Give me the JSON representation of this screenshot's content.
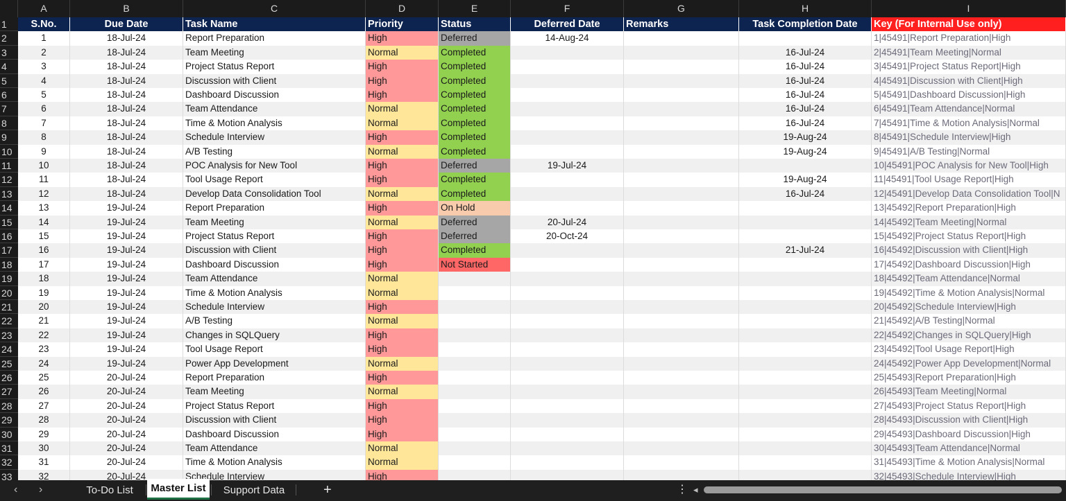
{
  "columns": [
    "A",
    "B",
    "C",
    "D",
    "E",
    "F",
    "G",
    "H",
    "I"
  ],
  "headers": {
    "sno": "S.No.",
    "due": "Due Date",
    "task": "Task Name",
    "priority": "Priority",
    "status": "Status",
    "deferred": "Deferred Date",
    "remarks": "Remarks",
    "completion": "Task Completion Date",
    "key": "Key (For Internal Use only)"
  },
  "colors": {
    "header_bg": "#0d2350",
    "key_header_bg": "#ff1f1f",
    "priority_high": "#ff9999",
    "priority_normal": "#ffe699",
    "status_completed": "#92d050",
    "status_deferred": "#a6a6a6",
    "status_onhold": "#f8cbad",
    "status_notstarted": "#ff6666"
  },
  "rows": [
    {
      "sno": "1",
      "due": "18-Jul-24",
      "task": "Report Preparation",
      "priority": "High",
      "status": "Deferred",
      "deferred": "14-Aug-24",
      "remarks": "",
      "completion": "",
      "key": "1|45491|Report Preparation|High"
    },
    {
      "sno": "2",
      "due": "18-Jul-24",
      "task": "Team Meeting",
      "priority": "Normal",
      "status": "Completed",
      "deferred": "",
      "remarks": "",
      "completion": "16-Jul-24",
      "key": "2|45491|Team Meeting|Normal"
    },
    {
      "sno": "3",
      "due": "18-Jul-24",
      "task": "Project Status Report",
      "priority": "High",
      "status": "Completed",
      "deferred": "",
      "remarks": "",
      "completion": "16-Jul-24",
      "key": "3|45491|Project Status Report|High"
    },
    {
      "sno": "4",
      "due": "18-Jul-24",
      "task": "Discussion with Client",
      "priority": "High",
      "status": "Completed",
      "deferred": "",
      "remarks": "",
      "completion": "16-Jul-24",
      "key": "4|45491|Discussion with Client|High"
    },
    {
      "sno": "5",
      "due": "18-Jul-24",
      "task": "Dashboard Discussion",
      "priority": "High",
      "status": "Completed",
      "deferred": "",
      "remarks": "",
      "completion": "16-Jul-24",
      "key": "5|45491|Dashboard Discussion|High"
    },
    {
      "sno": "6",
      "due": "18-Jul-24",
      "task": "Team Attendance",
      "priority": "Normal",
      "status": "Completed",
      "deferred": "",
      "remarks": "",
      "completion": "16-Jul-24",
      "key": "6|45491|Team Attendance|Normal"
    },
    {
      "sno": "7",
      "due": "18-Jul-24",
      "task": "Time & Motion Analysis",
      "priority": "Normal",
      "status": "Completed",
      "deferred": "",
      "remarks": "",
      "completion": "16-Jul-24",
      "key": "7|45491|Time & Motion Analysis|Normal"
    },
    {
      "sno": "8",
      "due": "18-Jul-24",
      "task": "Schedule Interview",
      "priority": "High",
      "status": "Completed",
      "deferred": "",
      "remarks": "",
      "completion": "19-Aug-24",
      "key": "8|45491|Schedule Interview|High"
    },
    {
      "sno": "9",
      "due": "18-Jul-24",
      "task": "A/B Testing",
      "priority": "Normal",
      "status": "Completed",
      "deferred": "",
      "remarks": "",
      "completion": "19-Aug-24",
      "key": "9|45491|A/B Testing|Normal"
    },
    {
      "sno": "10",
      "due": "18-Jul-24",
      "task": "POC Analysis for New Tool",
      "priority": "High",
      "status": "Deferred",
      "deferred": "19-Jul-24",
      "remarks": "",
      "completion": "",
      "key": "10|45491|POC Analysis for New Tool|High"
    },
    {
      "sno": "11",
      "due": "18-Jul-24",
      "task": "Tool Usage  Report",
      "priority": "High",
      "status": "Completed",
      "deferred": "",
      "remarks": "",
      "completion": "19-Aug-24",
      "key": "11|45491|Tool Usage  Report|High"
    },
    {
      "sno": "12",
      "due": "18-Jul-24",
      "task": "Develop Data Consolidation Tool",
      "priority": "Normal",
      "status": "Completed",
      "deferred": "",
      "remarks": "",
      "completion": "16-Jul-24",
      "key": "12|45491|Develop Data Consolidation Tool|N"
    },
    {
      "sno": "13",
      "due": "19-Jul-24",
      "task": "Report Preparation",
      "priority": "High",
      "status": "On Hold",
      "deferred": "",
      "remarks": "",
      "completion": "",
      "key": "13|45492|Report Preparation|High"
    },
    {
      "sno": "14",
      "due": "19-Jul-24",
      "task": "Team Meeting",
      "priority": "Normal",
      "status": "Deferred",
      "deferred": "20-Jul-24",
      "remarks": "",
      "completion": "",
      "key": "14|45492|Team Meeting|Normal"
    },
    {
      "sno": "15",
      "due": "19-Jul-24",
      "task": "Project Status Report",
      "priority": "High",
      "status": "Deferred",
      "deferred": "20-Oct-24",
      "remarks": "",
      "completion": "",
      "key": "15|45492|Project Status Report|High"
    },
    {
      "sno": "16",
      "due": "19-Jul-24",
      "task": "Discussion with Client",
      "priority": "High",
      "status": "Completed",
      "deferred": "",
      "remarks": "",
      "completion": "21-Jul-24",
      "key": "16|45492|Discussion with Client|High"
    },
    {
      "sno": "17",
      "due": "19-Jul-24",
      "task": "Dashboard Discussion",
      "priority": "High",
      "status": "Not Started",
      "deferred": "",
      "remarks": "",
      "completion": "",
      "key": "17|45492|Dashboard Discussion|High"
    },
    {
      "sno": "18",
      "due": "19-Jul-24",
      "task": "Team Attendance",
      "priority": "Normal",
      "status": "",
      "deferred": "",
      "remarks": "",
      "completion": "",
      "key": "18|45492|Team Attendance|Normal"
    },
    {
      "sno": "19",
      "due": "19-Jul-24",
      "task": "Time & Motion Analysis",
      "priority": "Normal",
      "status": "",
      "deferred": "",
      "remarks": "",
      "completion": "",
      "key": "19|45492|Time & Motion Analysis|Normal"
    },
    {
      "sno": "20",
      "due": "19-Jul-24",
      "task": "Schedule Interview",
      "priority": "High",
      "status": "",
      "deferred": "",
      "remarks": "",
      "completion": "",
      "key": "20|45492|Schedule Interview|High"
    },
    {
      "sno": "21",
      "due": "19-Jul-24",
      "task": "A/B Testing",
      "priority": "Normal",
      "status": "",
      "deferred": "",
      "remarks": "",
      "completion": "",
      "key": "21|45492|A/B Testing|Normal"
    },
    {
      "sno": "22",
      "due": "19-Jul-24",
      "task": "Changes in SQLQuery",
      "priority": "High",
      "status": "",
      "deferred": "",
      "remarks": "",
      "completion": "",
      "key": "22|45492|Changes in SQLQuery|High"
    },
    {
      "sno": "23",
      "due": "19-Jul-24",
      "task": "Tool Usage  Report",
      "priority": "High",
      "status": "",
      "deferred": "",
      "remarks": "",
      "completion": "",
      "key": "23|45492|Tool Usage  Report|High"
    },
    {
      "sno": "24",
      "due": "19-Jul-24",
      "task": "Power App Development",
      "priority": "Normal",
      "status": "",
      "deferred": "",
      "remarks": "",
      "completion": "",
      "key": "24|45492|Power App Development|Normal"
    },
    {
      "sno": "25",
      "due": "20-Jul-24",
      "task": "Report Preparation",
      "priority": "High",
      "status": "",
      "deferred": "",
      "remarks": "",
      "completion": "",
      "key": "25|45493|Report Preparation|High"
    },
    {
      "sno": "26",
      "due": "20-Jul-24",
      "task": "Team Meeting",
      "priority": "Normal",
      "status": "",
      "deferred": "",
      "remarks": "",
      "completion": "",
      "key": "26|45493|Team Meeting|Normal"
    },
    {
      "sno": "27",
      "due": "20-Jul-24",
      "task": "Project Status Report",
      "priority": "High",
      "status": "",
      "deferred": "",
      "remarks": "",
      "completion": "",
      "key": "27|45493|Project Status Report|High"
    },
    {
      "sno": "28",
      "due": "20-Jul-24",
      "task": "Discussion with Client",
      "priority": "High",
      "status": "",
      "deferred": "",
      "remarks": "",
      "completion": "",
      "key": "28|45493|Discussion with Client|High"
    },
    {
      "sno": "29",
      "due": "20-Jul-24",
      "task": "Dashboard Discussion",
      "priority": "High",
      "status": "",
      "deferred": "",
      "remarks": "",
      "completion": "",
      "key": "29|45493|Dashboard Discussion|High"
    },
    {
      "sno": "30",
      "due": "20-Jul-24",
      "task": "Team Attendance",
      "priority": "Normal",
      "status": "",
      "deferred": "",
      "remarks": "",
      "completion": "",
      "key": "30|45493|Team Attendance|Normal"
    },
    {
      "sno": "31",
      "due": "20-Jul-24",
      "task": "Time & Motion Analysis",
      "priority": "Normal",
      "status": "",
      "deferred": "",
      "remarks": "",
      "completion": "",
      "key": "31|45493|Time & Motion Analysis|Normal"
    },
    {
      "sno": "32",
      "due": "20-Jul-24",
      "task": "Schedule Interview",
      "priority": "High",
      "status": "",
      "deferred": "",
      "remarks": "",
      "completion": "",
      "key": "32|45493|Schedule Interview|High"
    }
  ],
  "sheet_tabs": [
    {
      "label": "To-Do List",
      "active": false
    },
    {
      "label": "Master List",
      "active": true
    },
    {
      "label": "Support Data",
      "active": false
    }
  ],
  "tabbar": {
    "prev_icon": "‹",
    "next_icon": "›",
    "add_icon": "+",
    "more_icon": "⋮",
    "scroll_left_icon": "◂"
  }
}
